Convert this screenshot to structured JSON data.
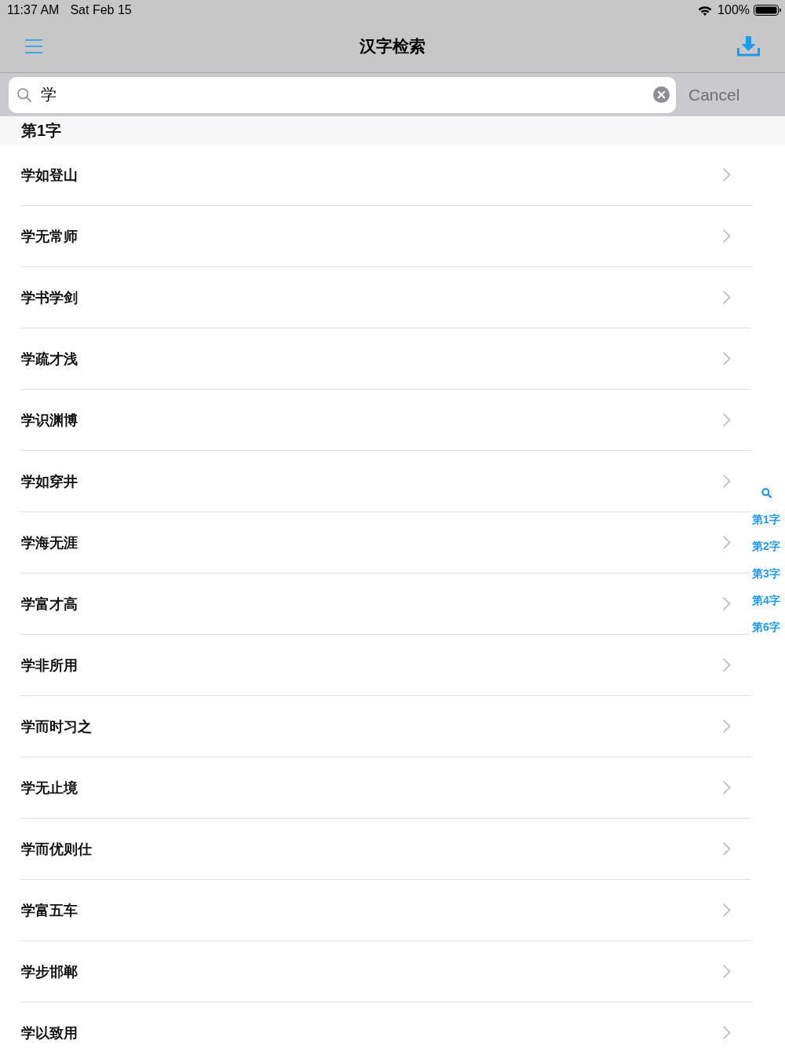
{
  "status_bar": {
    "time": "11:37 AM",
    "date": "Sat Feb 15",
    "battery": "100%"
  },
  "nav_bar": {
    "title": "汉字检索"
  },
  "search": {
    "value": "学",
    "cancel": {
      "label": "Cancel",
      "disabled": true
    }
  },
  "sections": [
    {
      "title": "第1字",
      "rows": [
        "学如登山",
        "学无常师",
        "学书学剑",
        "学疏才浅",
        "学识渊博",
        "学如穿井",
        "学海无涯",
        "学富才高",
        "学非所用",
        "学而时习之",
        "学无止境",
        "学而优则仕",
        "学富五车",
        "学步邯郸",
        "学以致用"
      ]
    }
  ],
  "index": {
    "items": [
      "第1字",
      "第2字",
      "第3字",
      "第4字",
      "第6字"
    ]
  }
}
